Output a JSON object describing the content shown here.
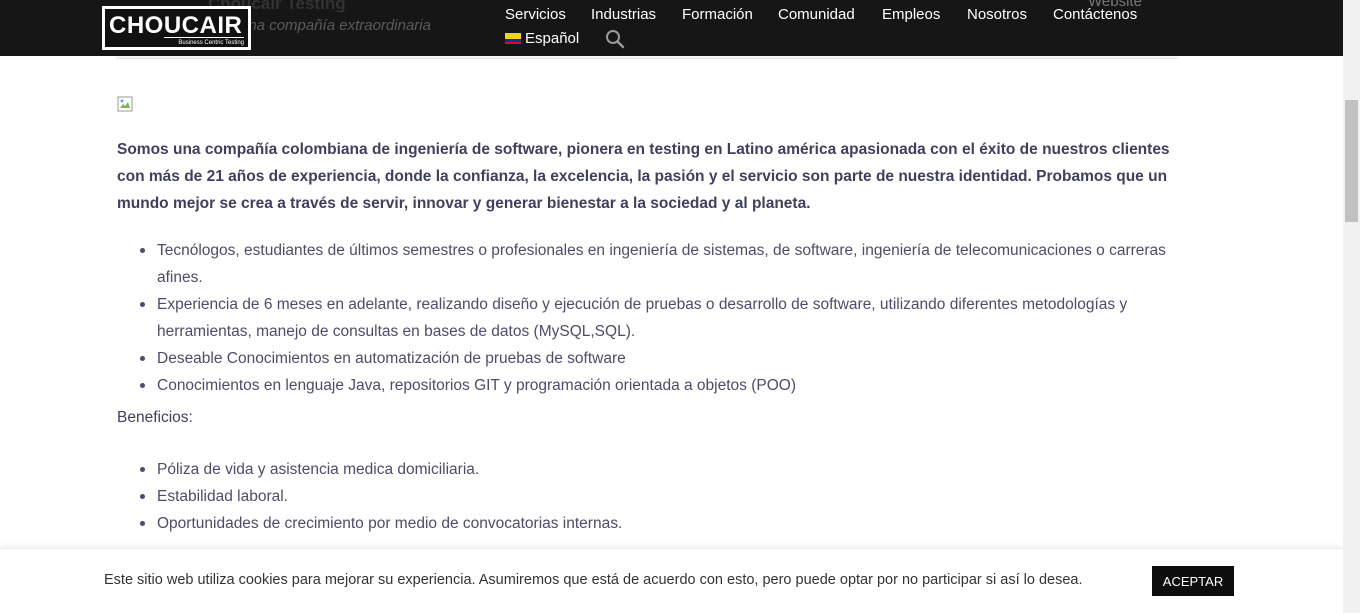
{
  "header": {
    "logo_text": "CHOUCAIR",
    "logo_tagline": "Business Centric Testing",
    "under_title": "Choucair Testing",
    "under_subtitle": "una compañía extraordinaria",
    "under_website": "Website",
    "nav": [
      {
        "label": "Servicios"
      },
      {
        "label": "Industrias"
      },
      {
        "label": "Formación"
      },
      {
        "label": "Comunidad"
      },
      {
        "label": "Empleos"
      },
      {
        "label": "Nosotros"
      },
      {
        "label": "Contáctenos"
      }
    ],
    "language": "Español",
    "colors": {
      "bar": "#161616",
      "text": "#ffffff"
    }
  },
  "content": {
    "intro": "Somos una compañía colombiana de ingeniería de software, pionera en testing en Latino américa apasionada con el éxito de nuestros clientes con más de 21 años de experiencia, donde la confianza, la excelencia, la pasión y el servicio son parte de nuestra identidad. Probamos que un mundo mejor se crea a través de servir, innovar y generar bienestar a la sociedad y al planeta.",
    "requirements": [
      "Tecnólogos, estudiantes de últimos semestres o profesionales en ingeniería de sistemas, de software, ingeniería de telecomunicaciones o carreras afines.",
      "Experiencia de 6 meses en adelante, realizando diseño y ejecución de pruebas o desarrollo de software, utilizando diferentes metodologías y herramientas, manejo de consultas en bases de datos (MySQL,SQL).",
      "Deseable Conocimientos en automatización de pruebas de software",
      "Conocimientos en lenguaje Java, repositorios GIT y programación orientada a objetos (POO)"
    ],
    "benefits_heading": "Beneficios:",
    "benefits": [
      "Póliza de vida y asistencia medica domiciliaria.",
      "Estabilidad laboral.",
      "Oportunidades de crecimiento por medio de convocatorias internas."
    ]
  },
  "cookie_bar": {
    "text": "Este sitio web utiliza cookies para mejorar su experiencia. Asumiremos que está de acuerdo con esto, pero puede optar por no participar si así lo desea.",
    "accept_label": "ACEPTAR"
  }
}
